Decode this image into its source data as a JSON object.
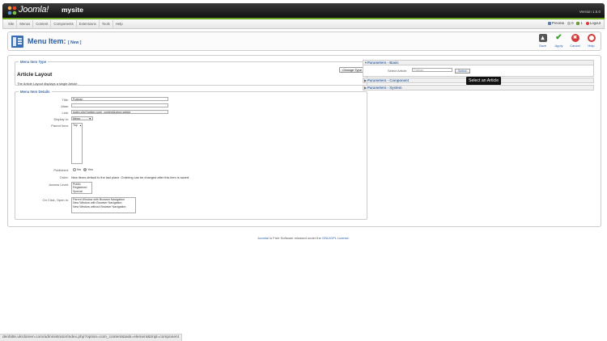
{
  "header": {
    "logo_text": "Joomla!",
    "site_name": "mysite",
    "version": "Version 1.5.0"
  },
  "menubar": {
    "items": [
      "Site",
      "Menus",
      "Content",
      "Components",
      "Extensions",
      "Tools",
      "Help"
    ],
    "preview": "Preview",
    "messages": "0",
    "users": "1",
    "logout": "Logout"
  },
  "toolbar": {
    "title": "Menu Item:",
    "subtitle": "[ New ]",
    "buttons": [
      {
        "label": "Save",
        "icon": "save-icon",
        "color": "#555555"
      },
      {
        "label": "Apply",
        "icon": "check-icon",
        "color": "#3aa02a"
      },
      {
        "label": "Cancel",
        "icon": "cancel-icon",
        "color": "#d23b3b"
      },
      {
        "label": "Help",
        "icon": "help-icon",
        "color": "#d23b3b"
      }
    ]
  },
  "menu_item_type": {
    "legend": "Menu Item Type",
    "type_title": "Article Layout",
    "description": "The Article Layout displays a single Article.",
    "change_button": "Change Type"
  },
  "details": {
    "legend": "Menu Item Details",
    "title_label": "Title:",
    "title_value": "Fratean",
    "alias_label": "Alias:",
    "alias_value": "",
    "link_label": "Link:",
    "link_value": "index.php?option=com_content&view=article",
    "display_label": "Display in:",
    "display_value": "Menu",
    "parent_label": "Parent Item:",
    "parent_value": "Top",
    "published_label": "Published:",
    "published_no": "No",
    "published_yes": "Yes",
    "order_label": "Order:",
    "order_text": "New items default to the last place. Ordering can be changed after this item is saved.",
    "access_label": "Access Level:",
    "access_options": [
      "Public",
      "Registered",
      "Special"
    ],
    "onclick_label": "On Click, Open in:",
    "onclick_options": [
      "Parent Window with Browser Navigation",
      "New Window with Browser Navigation",
      "New Window without Browser Navigation"
    ]
  },
  "params": {
    "basic_title": "Parameters - Basic",
    "select_article_label": "Select Article:",
    "select_article_value": "Fratean",
    "select_button": "Select",
    "component_title": "Parameters - Component",
    "system_title": "Parameters - System",
    "tooltip": "Select an Article"
  },
  "footer": {
    "joomla_link": "Joomla!",
    "text": "is Free Software released under the",
    "license_link": "GNU/GPL License."
  },
  "statusbar": {
    "url": "denbitte.ukrdomen.com/administrator/index.php?option=com_content&task=element&tmpl=component"
  }
}
